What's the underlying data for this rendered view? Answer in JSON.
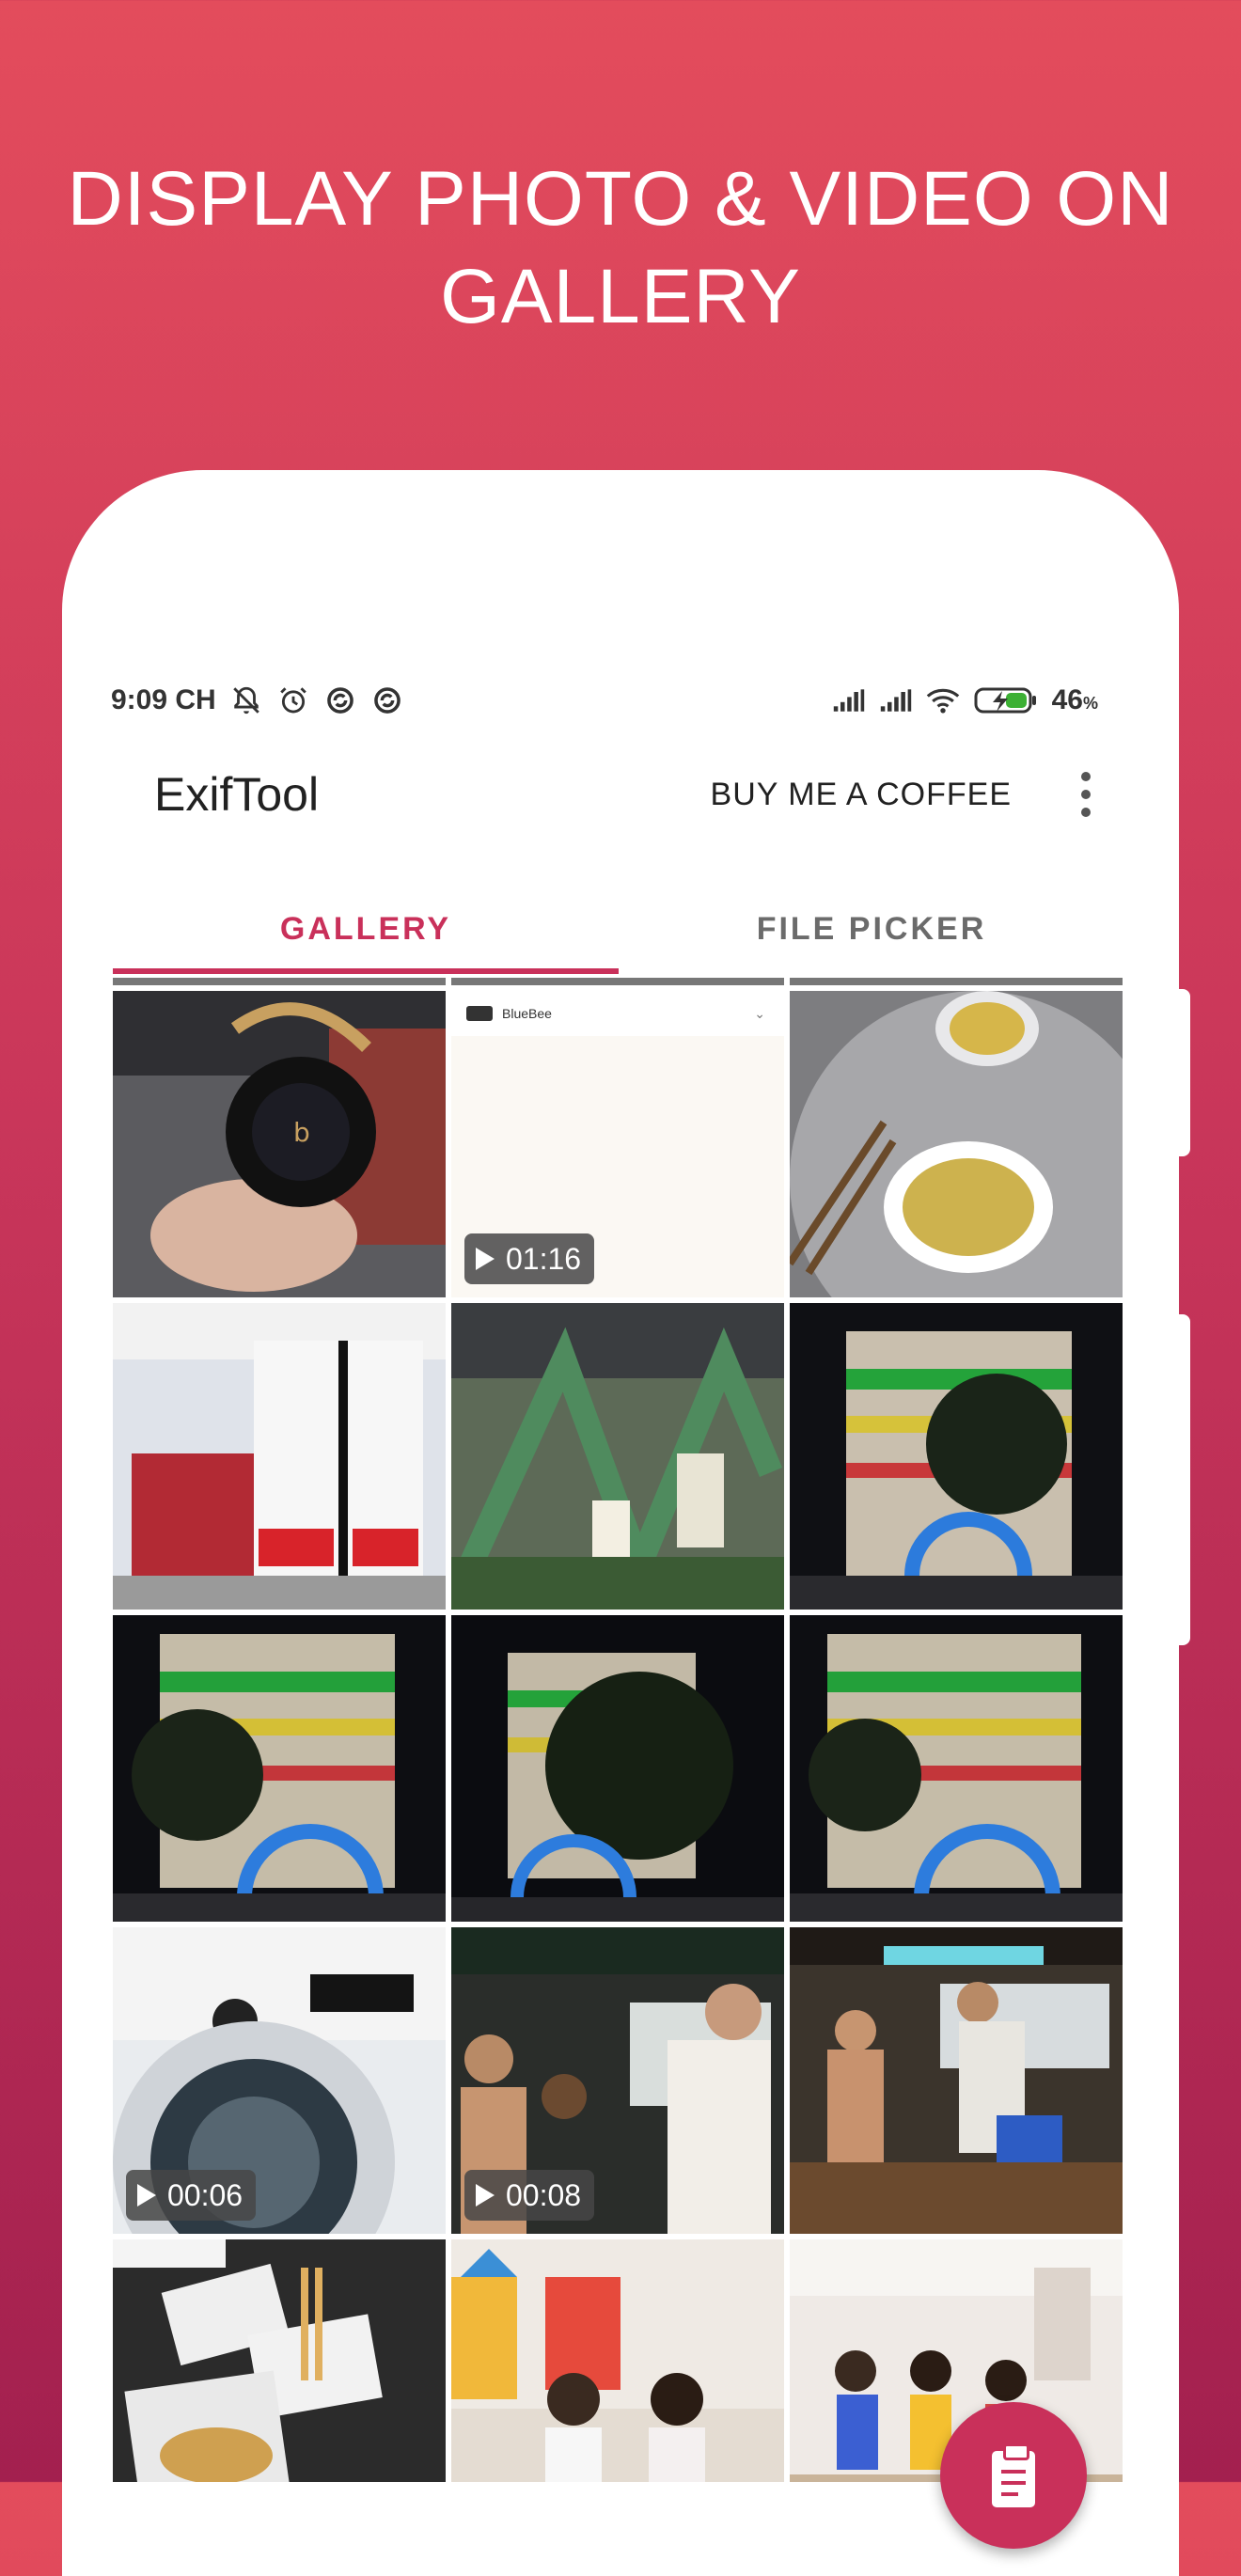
{
  "headline": {
    "line1": "DISPLAY PHOTO & VIDEO ON",
    "line2": "GALLERY"
  },
  "status_bar": {
    "time": "9:09 CH",
    "left_icons": [
      "muted-bell-icon",
      "alarm-icon",
      "sync-icon",
      "sync-icon"
    ],
    "right_icons": [
      "signal-icon",
      "signal-icon",
      "wifi-icon",
      "battery-charging-icon"
    ],
    "battery_value": "46",
    "battery_unit": "%"
  },
  "app_bar": {
    "title": "ExifTool",
    "coffee_label": "BUY ME A COFFEE",
    "more_icon": "more-vert-icon"
  },
  "tabs": [
    {
      "label": "GALLERY",
      "active": true
    },
    {
      "label": "FILE PICKER",
      "active": false
    }
  ],
  "gallery": {
    "items": [
      {
        "type": "photo",
        "subject": "headphones"
      },
      {
        "type": "video",
        "duration": "01:16",
        "subject": "screen-recording",
        "app_label": "BlueBee"
      },
      {
        "type": "photo",
        "subject": "noodles"
      },
      {
        "type": "photo",
        "subject": "supermarket"
      },
      {
        "type": "photo",
        "subject": "display"
      },
      {
        "type": "photo",
        "subject": "building-night"
      },
      {
        "type": "photo",
        "subject": "building-night"
      },
      {
        "type": "photo",
        "subject": "building-night"
      },
      {
        "type": "photo",
        "subject": "building-night"
      },
      {
        "type": "video",
        "duration": "00:06",
        "subject": "washing-machine"
      },
      {
        "type": "video",
        "duration": "00:08",
        "subject": "party"
      },
      {
        "type": "photo",
        "subject": "party-room"
      },
      {
        "type": "photo",
        "subject": "food"
      },
      {
        "type": "photo",
        "subject": "kids-room"
      },
      {
        "type": "photo",
        "subject": "kids-group"
      }
    ]
  },
  "fab": {
    "icon": "clipboard-icon"
  },
  "colors": {
    "accent": "#c9305a",
    "background_top": "#e34c5c",
    "background_bottom": "#a3204f"
  }
}
